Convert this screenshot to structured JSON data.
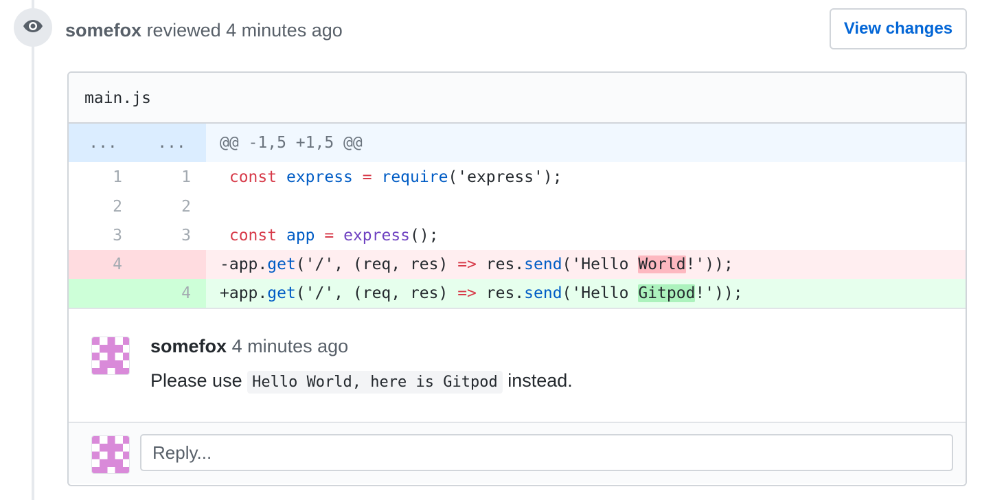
{
  "review": {
    "author": "somefox",
    "action": "reviewed",
    "time": "4 minutes ago",
    "view_changes_label": "View changes",
    "icon": "eye-icon"
  },
  "file": {
    "name": "main.js",
    "hunk_header": "@@ -1,5 +1,5 @@",
    "hunk_old": "...",
    "hunk_new": "...",
    "lines": [
      {
        "old": "1",
        "new": "1",
        "type": "context",
        "text": " const express = require('express');"
      },
      {
        "old": "2",
        "new": "2",
        "type": "context",
        "text": ""
      },
      {
        "old": "3",
        "new": "3",
        "type": "context",
        "text": " const app = express();"
      },
      {
        "old": "4",
        "new": "",
        "type": "deletion",
        "text": "-app.get('/', (req, res) => res.send('Hello World!'));"
      },
      {
        "old": "",
        "new": "4",
        "type": "addition",
        "text": "+app.get('/', (req, res) => res.send('Hello Gitpod!'));"
      }
    ],
    "tokens": {
      "const": "const",
      "express": "express",
      "eq": "=",
      "require": "require",
      "express_arg": "('express');",
      "app": "app",
      "express_call": "express",
      "call_end": "();",
      "minus": "-",
      "plus": "+",
      "app_dot": "app.",
      "get": "get",
      "route_args": "('/', (req, res) ",
      "arrow": "=>",
      "res_dot": " res.",
      "send": "send",
      "hello": "('Hello ",
      "world": "World",
      "gitpod": "Gitpod",
      "tail": "!'));"
    }
  },
  "comment": {
    "author": "somefox",
    "time": "4 minutes ago",
    "body_prefix": "Please use ",
    "body_code": "Hello World, here is Gitpod",
    "body_suffix": " instead."
  },
  "reply": {
    "placeholder": "Reply..."
  },
  "colors": {
    "link": "#0366d6",
    "deletion_bg": "#ffeef0",
    "addition_bg": "#e6ffed",
    "hunk_bg": "#f1f8ff",
    "avatar_pink": "#d98ad9"
  }
}
